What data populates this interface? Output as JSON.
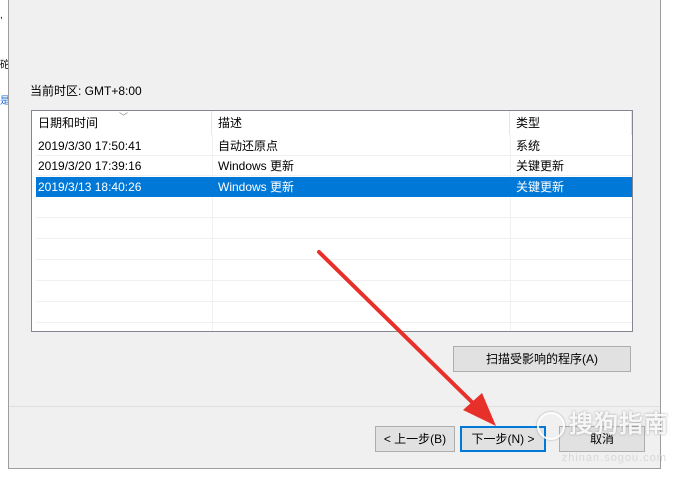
{
  "background_fragments": [
    ",",
    "砣",
    "是"
  ],
  "dialog": {
    "timezone_label": "当前时区: GMT+8:00",
    "columns": [
      "日期和时间",
      "描述",
      "类型"
    ],
    "rows": [
      {
        "datetime": "2019/3/30 17:50:41",
        "description": "自动还原点",
        "type": "系统"
      },
      {
        "datetime": "2019/3/20 17:39:16",
        "description": "Windows 更新",
        "type": "关键更新"
      },
      {
        "datetime": "2019/3/13 18:40:26",
        "description": "Windows 更新",
        "type": "关键更新"
      }
    ],
    "scan_button": "扫描受影响的程序(A)",
    "back_button": "< 上一步(B)",
    "next_button": "下一步(N) >",
    "cancel_button": "取消"
  },
  "watermark": {
    "text": "搜狗指南",
    "url": "zhinan.sogou.com"
  },
  "colors": {
    "selection": "#0078d7",
    "arrow": "#e8302a"
  }
}
